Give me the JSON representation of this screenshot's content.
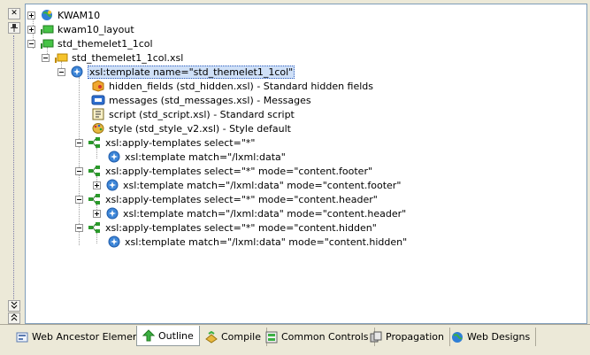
{
  "side": {
    "close_glyph": "✕",
    "pin_glyph": "📌",
    "first_glyph": "◂◂",
    "last_glyph": "▸▸"
  },
  "tree": {
    "kwam10": "KWAM10",
    "kwam10_layout": "kwam10_layout",
    "std_themelet": "std_themelet1_1col",
    "std_themelet_xsl": "std_themelet1_1col.xsl",
    "template_root": "xsl:template name=\"std_themelet1_1col\"",
    "hidden_fields": "hidden_fields (std_hidden.xsl) - Standard hidden fields",
    "messages": "messages (std_messages.xsl) - Messages",
    "script": "script (std_script.xsl) - Standard script",
    "style": "style (std_style_v2.xsl) - Style default",
    "apply1": "xsl:apply-templates select=\"*\"",
    "match1": "xsl:template match=\"/lxml:data\"",
    "apply2": "xsl:apply-templates select=\"*\" mode=\"content.footer\"",
    "match2": "xsl:template match=\"/lxml:data\" mode=\"content.footer\"",
    "apply3": "xsl:apply-templates select=\"*\" mode=\"content.header\"",
    "match3": "xsl:template match=\"/lxml:data\" mode=\"content.header\"",
    "apply4": "xsl:apply-templates select=\"*\" mode=\"content.hidden\"",
    "match4": "xsl:template match=\"/lxml:data\" mode=\"content.hidden\""
  },
  "tabs": {
    "web_ancestor": "Web Ancestor Elements",
    "outline": "Outline",
    "compile": "Compile",
    "common_controls": "Common Controls",
    "propagation": "Propagation",
    "web_designs": "Web Designs"
  },
  "colors": {
    "panel_border": "#7f9db9",
    "selection": "#cfe0f7",
    "chrome": "#ece9d8"
  }
}
